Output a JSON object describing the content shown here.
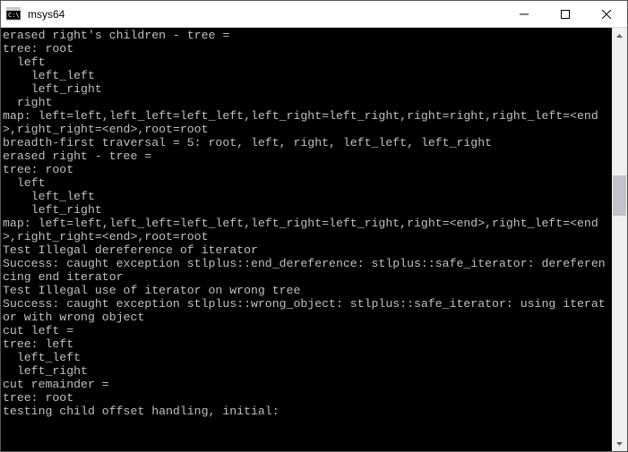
{
  "window": {
    "title": "msys64"
  },
  "terminal": {
    "lines": [
      "erased right's children - tree =",
      "tree: root",
      "  left",
      "    left_left",
      "    left_right",
      "  right",
      "map: left=left,left_left=left_left,left_right=left_right,right=right,right_left=<end>,right_right=<end>,root=root",
      "breadth-first traversal = 5: root, left, right, left_left, left_right",
      "erased right - tree =",
      "tree: root",
      "  left",
      "    left_left",
      "    left_right",
      "map: left=left,left_left=left_left,left_right=left_right,right=<end>,right_left=<end>,right_right=<end>,root=root",
      "Test Illegal dereference of iterator",
      "Success: caught exception stlplus::end_dereference: stlplus::safe_iterator: dereferencing end iterator",
      "Test Illegal use of iterator on wrong tree",
      "Success: caught exception stlplus::wrong_object: stlplus::safe_iterator: using iterator with wrong object",
      "cut left =",
      "tree: left",
      "  left_left",
      "  left_right",
      "cut remainder =",
      "tree: root",
      "testing child offset handling, initial:"
    ]
  }
}
